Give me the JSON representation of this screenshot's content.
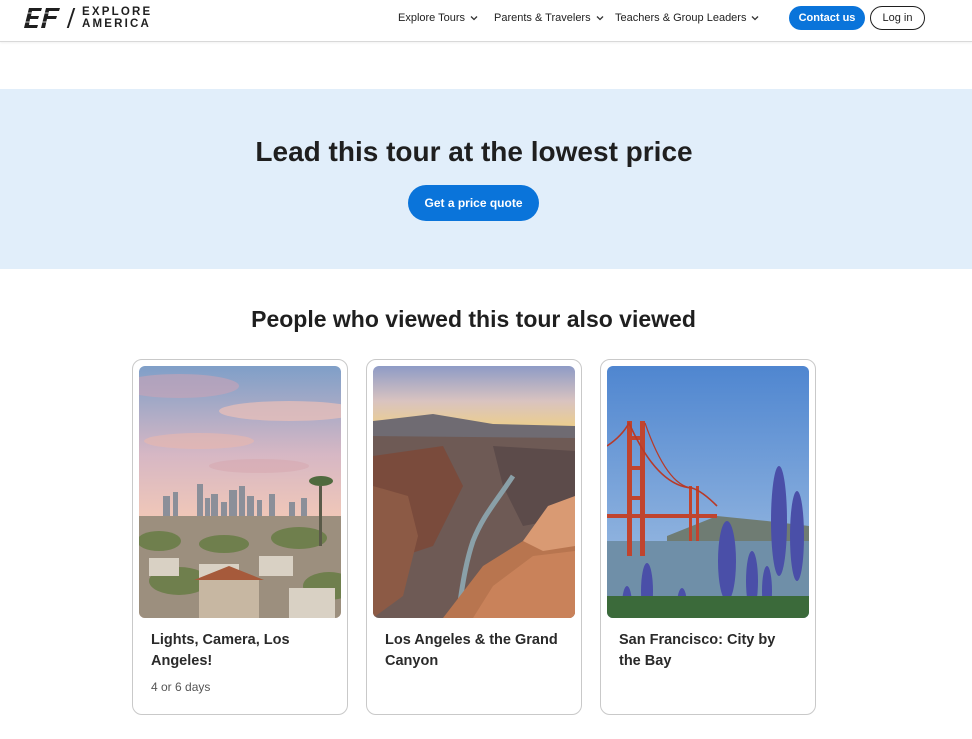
{
  "header": {
    "brand_line1": "EXPLORE",
    "brand_line2": "AMERICA",
    "nav": [
      {
        "label": "Explore Tours"
      },
      {
        "label": "Parents & Travelers"
      },
      {
        "label": "Teachers & Group Leaders"
      }
    ],
    "contact_label": "Contact us",
    "login_label": "Log in",
    "accent_color": "#0a74da"
  },
  "banner": {
    "title": "Lead this tour at the lowest price",
    "button_label": "Get a price quote",
    "background": "#e1eefa"
  },
  "also_viewed": {
    "title": "People who viewed this tour also viewed",
    "cards": [
      {
        "title": "Lights, Camera, Los Angeles!",
        "subtitle": "4 or 6 days",
        "image": "los-angeles-skyline-photo"
      },
      {
        "title": "Los Angeles & the Grand Canyon",
        "image": "grand-canyon-photo"
      },
      {
        "title": "San Francisco: City by the Bay",
        "image": "golden-gate-bridge-photo"
      }
    ]
  }
}
